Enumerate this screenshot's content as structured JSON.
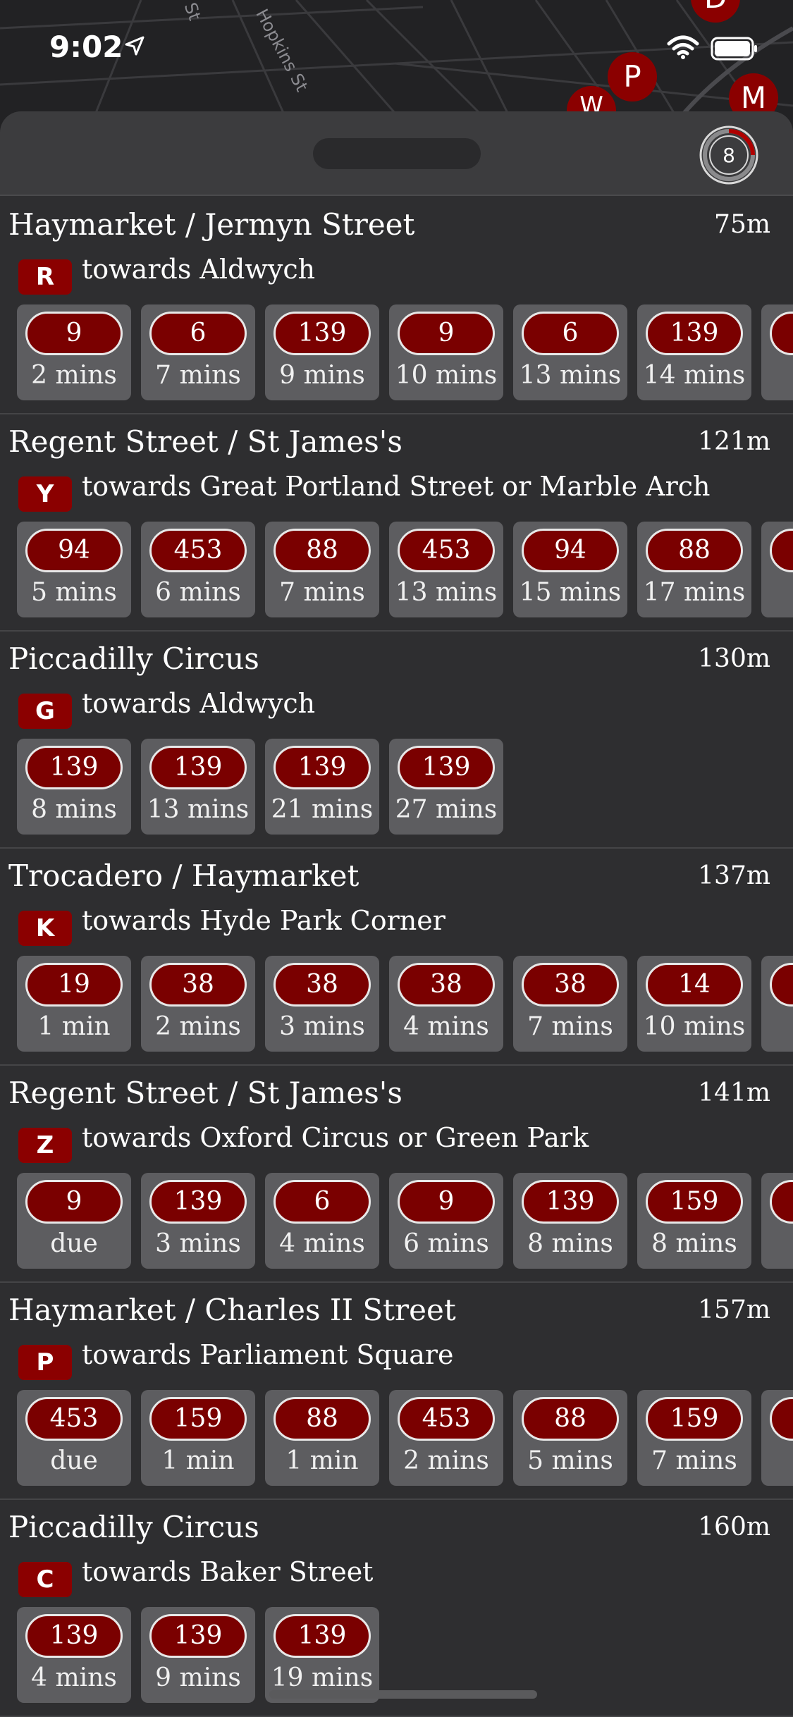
{
  "status_bar": {
    "time": "9:02"
  },
  "map": {
    "street_labels": [
      "St",
      "Hopkins St"
    ],
    "pins": [
      "D",
      "P",
      "M",
      "W"
    ]
  },
  "sheet": {
    "nearby_count": "8",
    "accent_color": "#8b0000"
  },
  "stops": [
    {
      "name": "Haymarket / Jermyn Street",
      "distance": "75m",
      "letter": "R",
      "towards": "towards Aldwych",
      "arrivals": [
        {
          "route": "9",
          "eta": "2 mins"
        },
        {
          "route": "6",
          "eta": "7 mins"
        },
        {
          "route": "139",
          "eta": "9 mins"
        },
        {
          "route": "9",
          "eta": "10 mins"
        },
        {
          "route": "6",
          "eta": "13 mins"
        },
        {
          "route": "139",
          "eta": "14 mins"
        },
        {
          "route": "",
          "eta": ""
        }
      ]
    },
    {
      "name": "Regent Street / St James's",
      "distance": "121m",
      "letter": "Y",
      "towards": "towards Great Portland Street or Marble Arch",
      "arrivals": [
        {
          "route": "94",
          "eta": "5 mins"
        },
        {
          "route": "453",
          "eta": "6 mins"
        },
        {
          "route": "88",
          "eta": "7 mins"
        },
        {
          "route": "453",
          "eta": "13 mins"
        },
        {
          "route": "94",
          "eta": "15 mins"
        },
        {
          "route": "88",
          "eta": "17 mins"
        },
        {
          "route": "",
          "eta": ""
        }
      ]
    },
    {
      "name": "Piccadilly Circus",
      "distance": "130m",
      "letter": "G",
      "towards": "towards Aldwych",
      "arrivals": [
        {
          "route": "139",
          "eta": "8 mins"
        },
        {
          "route": "139",
          "eta": "13 mins"
        },
        {
          "route": "139",
          "eta": "21 mins"
        },
        {
          "route": "139",
          "eta": "27 mins"
        }
      ]
    },
    {
      "name": "Trocadero / Haymarket",
      "distance": "137m",
      "letter": "K",
      "towards": "towards Hyde Park Corner",
      "arrivals": [
        {
          "route": "19",
          "eta": "1 min"
        },
        {
          "route": "38",
          "eta": "2 mins"
        },
        {
          "route": "38",
          "eta": "3 mins"
        },
        {
          "route": "38",
          "eta": "4 mins"
        },
        {
          "route": "38",
          "eta": "7 mins"
        },
        {
          "route": "14",
          "eta": "10 mins"
        },
        {
          "route": "",
          "eta": ""
        }
      ]
    },
    {
      "name": "Regent Street / St James's",
      "distance": "141m",
      "letter": "Z",
      "towards": "towards Oxford Circus or Green Park",
      "arrivals": [
        {
          "route": "9",
          "eta": "due"
        },
        {
          "route": "139",
          "eta": "3 mins"
        },
        {
          "route": "6",
          "eta": "4 mins"
        },
        {
          "route": "9",
          "eta": "6 mins"
        },
        {
          "route": "139",
          "eta": "8 mins"
        },
        {
          "route": "159",
          "eta": "8 mins"
        },
        {
          "route": "",
          "eta": ""
        }
      ]
    },
    {
      "name": "Haymarket / Charles II Street",
      "distance": "157m",
      "letter": "P",
      "towards": "towards Parliament Square",
      "arrivals": [
        {
          "route": "453",
          "eta": "due"
        },
        {
          "route": "159",
          "eta": "1 min"
        },
        {
          "route": "88",
          "eta": "1 min"
        },
        {
          "route": "453",
          "eta": "2 mins"
        },
        {
          "route": "88",
          "eta": "5 mins"
        },
        {
          "route": "159",
          "eta": "7 mins"
        },
        {
          "route": "",
          "eta": ""
        }
      ]
    },
    {
      "name": "Piccadilly Circus",
      "distance": "160m",
      "letter": "C",
      "towards": "towards Baker Street",
      "arrivals": [
        {
          "route": "139",
          "eta": "4 mins"
        },
        {
          "route": "139",
          "eta": "9 mins"
        },
        {
          "route": "139",
          "eta": "19 mins"
        }
      ]
    }
  ]
}
